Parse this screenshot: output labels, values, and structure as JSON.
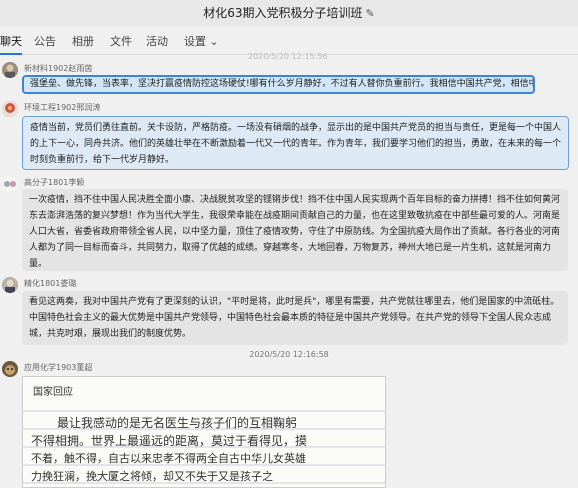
{
  "title": "材化63期入党积极分子培训班",
  "tabs": [
    "聊天",
    "公告",
    "相册",
    "文件",
    "活动",
    "设置"
  ],
  "faded_time": "2020/5/20 12:15:56",
  "messages": [
    {
      "sender": "新材料1902赵雨茵",
      "text": "强堡垒、做先锋，当表率，坚决打赢疫情防控这场硬仗!哪有什么岁月静好，不过有人替你负重前行。我相信中国共产党，相信中国"
    },
    {
      "sender": "环境工程1902邢润涛",
      "text": "疫情当前，党员们勇往直前。关卡设防，严格防疫。一场没有硝烟的战争，显示出的是中国共产党员的担当与责任，更是每一个中国人的上下一心，同舟共济。他们的英雄壮举在不断激励着一代又一代的青年。作为青年，我们要学习他们的担当，勇敢，在未来的每一个时刻负重前行，给下一代岁月静好。"
    },
    {
      "sender": "高分子1801李颖",
      "text": "一次疫情，挡不住中国人民决胜全面小康、决战脱贫攻坚的铿锵步伐！挡不住中国人民实现两个百年目标的奋力拼搏！挡不住如何黄河东去澎湃浩荡的复兴梦想！作为当代大学生，我很荣幸能在战疫期间贡献自己的力量，也在这里致敬抗疫在中部些最可爱的人。河南是人口大省，省委省政府带领全省人民，以中坚力量，顶住了疫情攻势，守住了中原防线。为全国抗疫大局作出了贡献。各行各业的河南人都为了同一目标而奋斗，共同努力，取得了优越的成绩。穿越寒冬，大地回春，万物复苏，神州大地已是一片生机，这就是河南力量。"
    },
    {
      "sender": "精化1801娄璐",
      "text": "看见这两奏，我对中国共产党有了更深刻的认识，\"平时是将，此时是兵\"，哪里有需要，共产党就往哪里去，他们是国家的中流砥柱。中国特色社会主义的最大优势是中国共产党领导，中国特色社会最本质的特征是中国共产党领导。在共产党的领导下全国人民众志成城，共克时艰，展现出我们的制度优势。"
    }
  ],
  "timestamp": "2020/5/20 12:16:58",
  "last_sender": "应用化学1903董超",
  "handwriting": [
    "国家回应",
    "最让我感动的是无名医生与孩子们的互相鞠躬",
    "不得相拥。世界上最遥远的距离，莫过于看得见，摸",
    "不着，触不得，自古以来忠孝不得两全自古中华儿女英雄",
    "力挽狂澜，挽大厦之将倾，却又不失于又是孩子之"
  ],
  "colors": {
    "selected_border": "#3a85d4",
    "tab_active_underline": "#2b73d9",
    "flag": "#de2910"
  }
}
